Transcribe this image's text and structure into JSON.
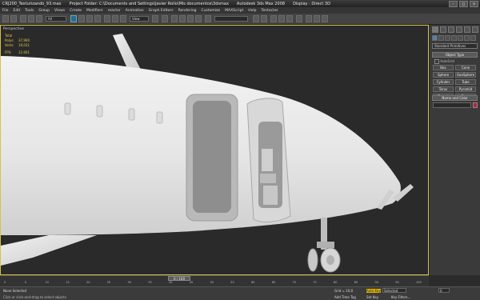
{
  "titlebar": {
    "file": "CRJ200_Texturizando_93.max",
    "project": "Project Folder: C:\\Documents and Settings\\Javier Rollo\\Mis documentos\\3dsmax",
    "app": "Autodesk 3ds Max 2008",
    "display": "Display : Direct 3D"
  },
  "menu": [
    "File",
    "Edit",
    "Tools",
    "Group",
    "Views",
    "Create",
    "Modifiers",
    "reactor",
    "Animation",
    "Graph Editors",
    "Rendering",
    "Customize",
    "MAXScript",
    "Help",
    "Tentacles"
  ],
  "toolbar": {
    "filter_value": "All",
    "refcoord_value": "View",
    "selset_value": ""
  },
  "viewport": {
    "label": "Perspective",
    "stats_title": "Total",
    "stats": [
      {
        "label": "Polys:",
        "value": "37,960"
      },
      {
        "label": "Verts:",
        "value": "19,031"
      },
      {
        "label": "FPS:",
        "value": "12.601"
      }
    ]
  },
  "command_panel": {
    "category": "Standard Primitives",
    "object_type_header": "Object Type",
    "autogrid_label": "AutoGrid",
    "object_types": [
      "Box",
      "Cone",
      "Sphere",
      "GeoSphere",
      "Cylinder",
      "Tube",
      "Torus",
      "Pyramid",
      "Teapot",
      "Plane"
    ],
    "name_color_header": "Name and Color",
    "name_value": "",
    "color": "#c02040"
  },
  "timeline": {
    "frame_label": "0 / 100",
    "ticks": [
      "0",
      "5",
      "10",
      "15",
      "20",
      "25",
      "30",
      "35",
      "40",
      "45",
      "50",
      "55",
      "60",
      "65",
      "70",
      "75",
      "80",
      "85",
      "90",
      "95",
      "100"
    ]
  },
  "status": {
    "selection": "None Selected",
    "prompt": "Click or click-and-drag to select objects",
    "grid": "Grid = 10,0",
    "add_time_tag": "Add Time Tag",
    "auto_key": "Auto Key",
    "set_key": "Set Key",
    "selected_value": "Selected",
    "key_filters": "Key Filters...",
    "current_frame": "0"
  },
  "colors": {
    "viewport_border": "#d8c24a",
    "auto_key_active": "#e0b000",
    "selection_tool": "#2e6a8e"
  }
}
